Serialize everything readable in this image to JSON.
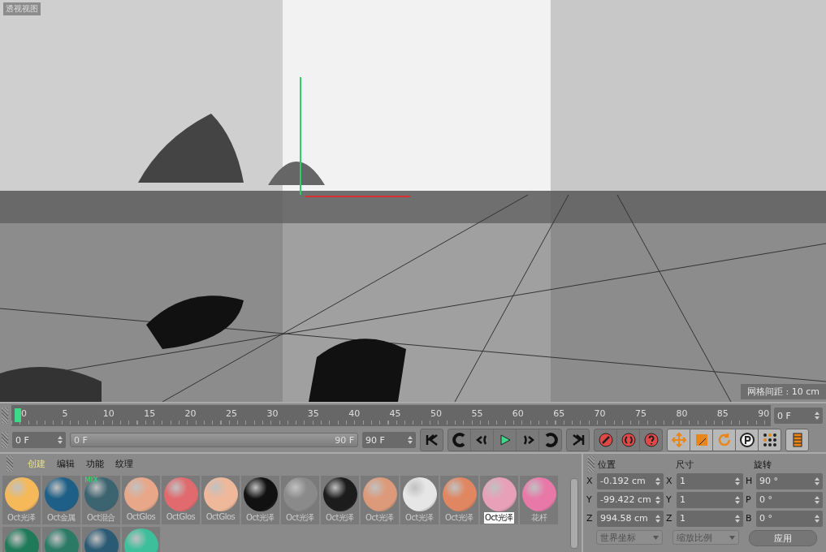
{
  "viewport": {
    "title": "透视视图",
    "grid_label": "网格间距 : 10 cm"
  },
  "timeline": {
    "ticks": [
      "0",
      "5",
      "10",
      "15",
      "20",
      "25",
      "30",
      "35",
      "40",
      "45",
      "50",
      "55",
      "60",
      "65",
      "70",
      "75",
      "80",
      "85",
      "90"
    ],
    "level": 0,
    "frame_field": "0 F"
  },
  "transport": {
    "start_field": "0 F",
    "range_start": "0 F",
    "range_end": "90 F",
    "end_field": "90 F"
  },
  "materials": {
    "menu": [
      {
        "label": "创建",
        "selected": true
      },
      {
        "label": "编辑",
        "selected": false
      },
      {
        "label": "功能",
        "selected": false
      },
      {
        "label": "纹理",
        "selected": false
      }
    ],
    "items": [
      {
        "name": "Oct光泽",
        "color": "#f5b95a",
        "selected": false
      },
      {
        "name": "Oct金属",
        "color": "#1d5f86",
        "selected": false
      },
      {
        "name": "Oct混合",
        "color": "#3b6470",
        "selected": false,
        "badge": "MIX"
      },
      {
        "name": "OctGlos",
        "color": "#e8a788",
        "selected": false
      },
      {
        "name": "OctGlos",
        "color": "#e06a6e",
        "selected": false
      },
      {
        "name": "OctGlos",
        "color": "#f0b89a",
        "selected": false
      },
      {
        "name": "Oct光泽",
        "color": "#111111",
        "selected": false
      },
      {
        "name": "Oct光泽",
        "color": "#8a8a8a",
        "selected": false
      },
      {
        "name": "Oct光泽",
        "color": "#1c1c1c",
        "selected": false
      },
      {
        "name": "Oct光泽",
        "color": "#dc9a7a",
        "selected": false
      },
      {
        "name": "Oct光泽",
        "color": "#e6e6e6",
        "selected": false
      },
      {
        "name": "Oct光泽",
        "color": "#e08660",
        "selected": false
      },
      {
        "name": "Oct光泽",
        "color": "#e8a0b8",
        "selected": true
      },
      {
        "name": "花杆",
        "color": "#e878a8",
        "selected": false
      },
      {
        "color": "#1f7a5a"
      },
      {
        "color": "#2a7a66"
      },
      {
        "color": "#2b5a74"
      },
      {
        "color": "#3cbf9a"
      }
    ]
  },
  "coordinates": {
    "headers": [
      "位置",
      "尺寸",
      "旋转"
    ],
    "rows": [
      {
        "axes": [
          "X",
          "X",
          "H"
        ],
        "values": [
          "-0.192 cm",
          "1",
          "90 °"
        ]
      },
      {
        "axes": [
          "Y",
          "Y",
          "P"
        ],
        "values": [
          "-99.422 cm",
          "1",
          "0 °"
        ]
      },
      {
        "axes": [
          "Z",
          "Z",
          "B"
        ],
        "values": [
          "994.58 cm",
          "1",
          "0 °"
        ]
      }
    ],
    "mode_dropdowns": [
      {
        "label": "世界坐标",
        "disabled": true
      },
      {
        "label": "缩放比例",
        "disabled": true
      }
    ],
    "apply_button": {
      "label": "应用",
      "disabled": true
    }
  }
}
